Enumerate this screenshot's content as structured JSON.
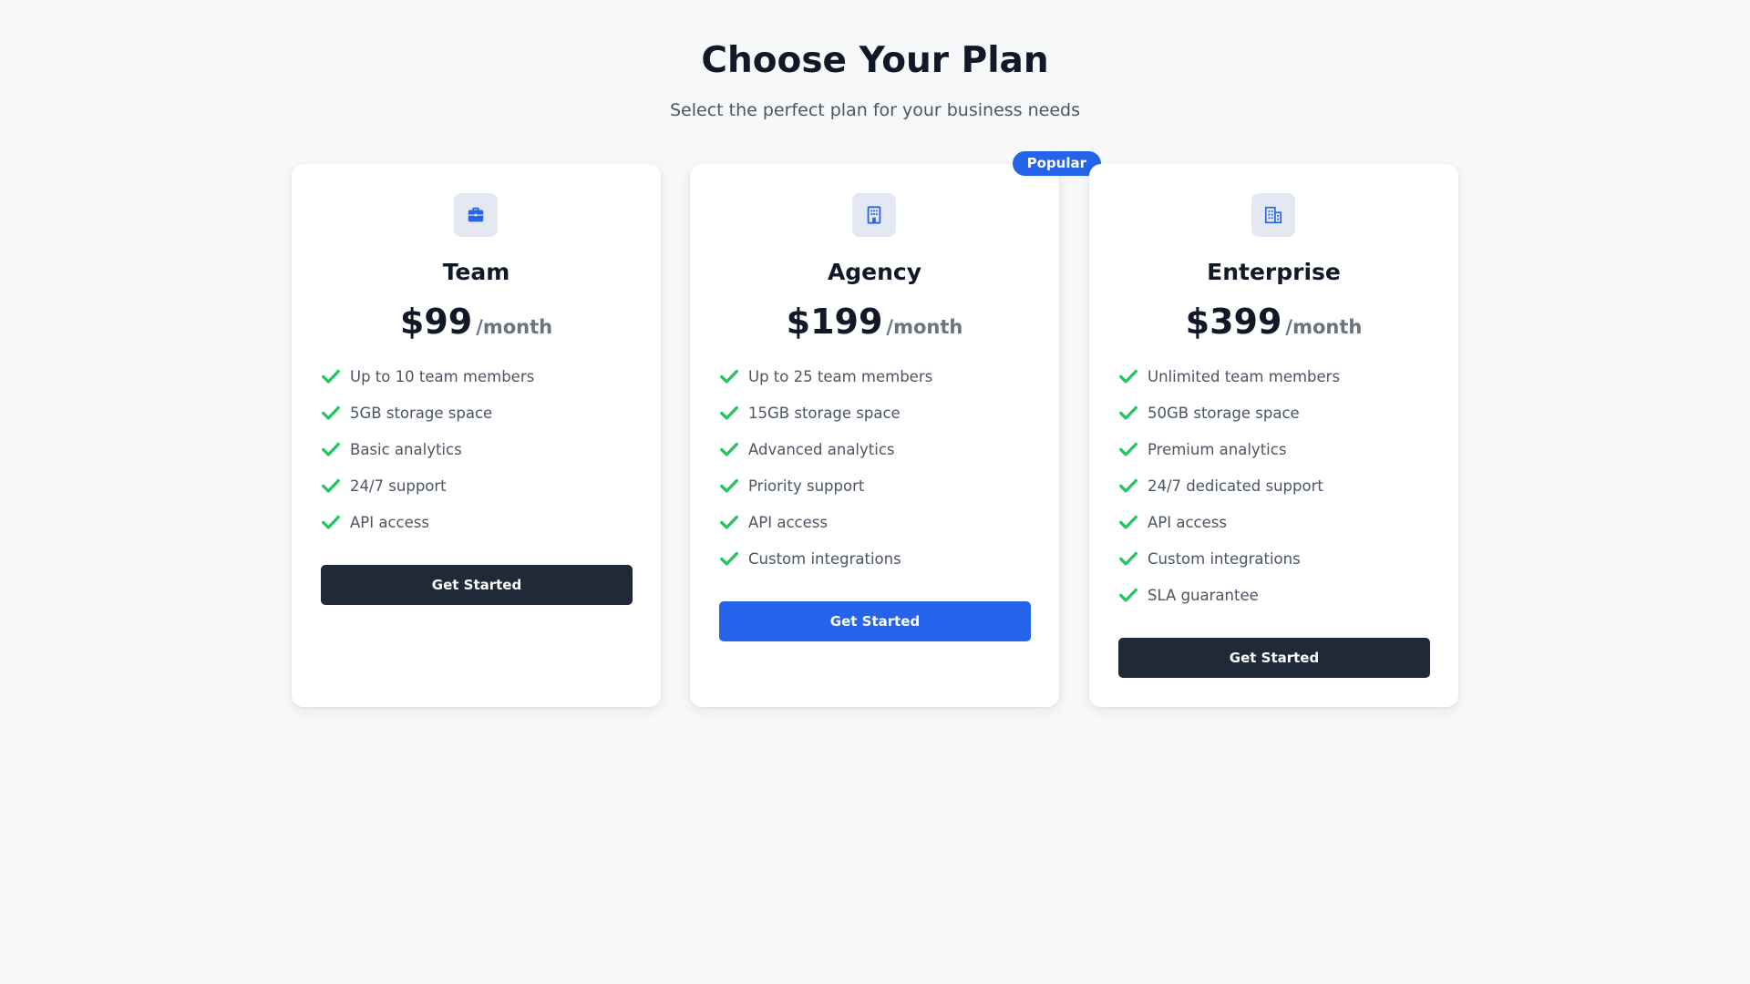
{
  "header": {
    "title": "Choose Your Plan",
    "subtitle": "Select the perfect plan for your business needs"
  },
  "colors": {
    "accent": "#2563eb",
    "dark_button": "#1f2937",
    "check": "#22c55e",
    "icon_tile": "#e3e8f2"
  },
  "plans": [
    {
      "name": "Team",
      "icon": "briefcase-icon",
      "price": "$99",
      "period": "/month",
      "features": [
        "Up to 10 team members",
        "5GB storage space",
        "Basic analytics",
        "24/7 support",
        "API access"
      ],
      "cta_label": "Get Started",
      "cta_style": "dark"
    },
    {
      "name": "Agency",
      "icon": "office-building-icon",
      "badge": "Popular",
      "price": "$199",
      "period": "/month",
      "features": [
        "Up to 25 team members",
        "15GB storage space",
        "Advanced analytics",
        "Priority support",
        "API access",
        "Custom integrations"
      ],
      "cta_label": "Get Started",
      "cta_style": "accent"
    },
    {
      "name": "Enterprise",
      "icon": "buildings-icon",
      "price": "$399",
      "period": "/month",
      "features": [
        "Unlimited team members",
        "50GB storage space",
        "Premium analytics",
        "24/7 dedicated support",
        "API access",
        "Custom integrations",
        "SLA guarantee"
      ],
      "cta_label": "Get Started",
      "cta_style": "dark"
    }
  ]
}
